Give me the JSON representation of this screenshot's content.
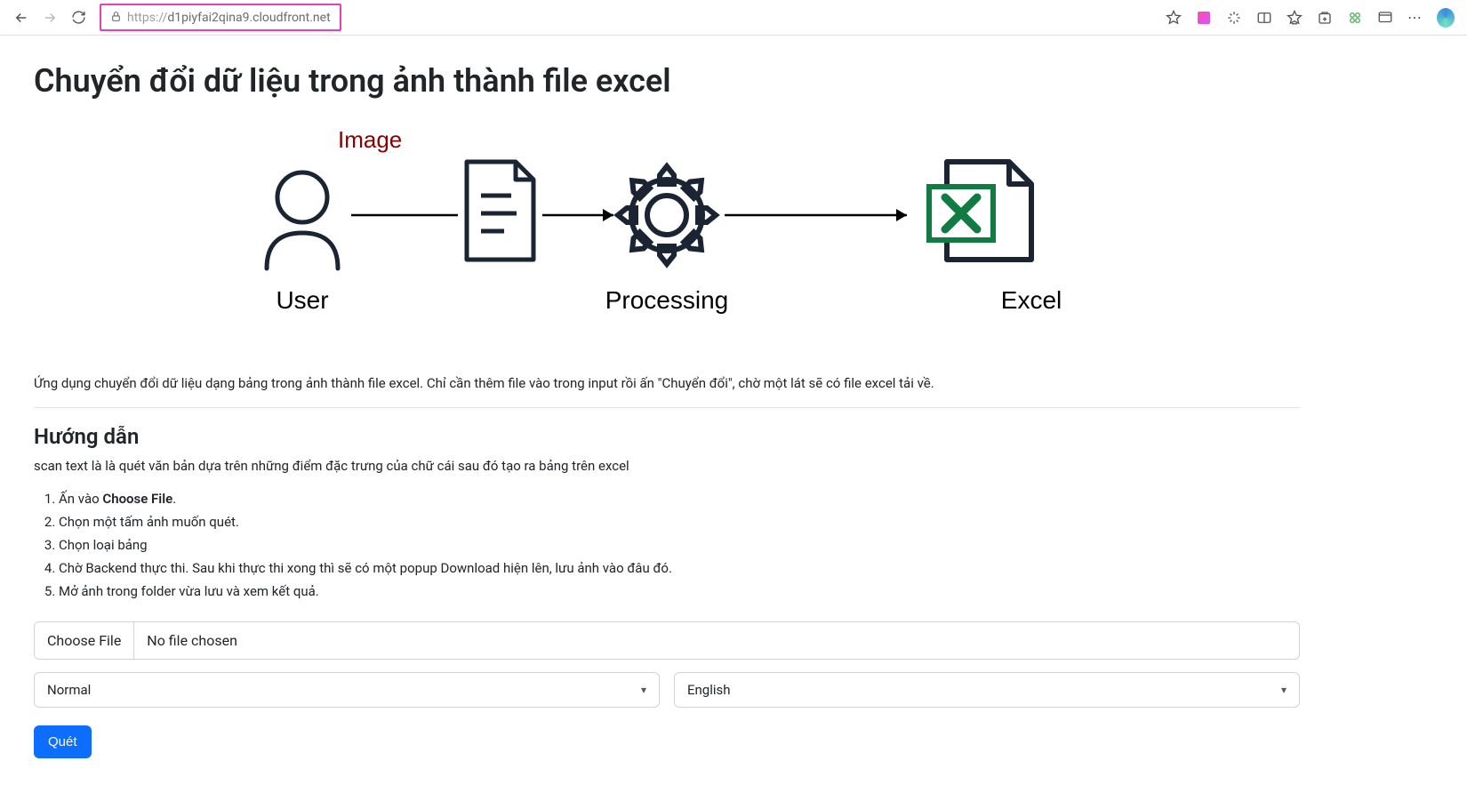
{
  "browser": {
    "url_protocol": "https://",
    "url_host": "d1piyfai2qina9.cloudfront.net"
  },
  "page": {
    "title": "Chuyển đổi dữ liệu trong ảnh thành file excel",
    "diagram": {
      "image_label": "Image",
      "user_label": "User",
      "processing_label": "Processing",
      "excel_label": "Excel"
    },
    "description": "Ứng dụng chuyển đổi dữ liệu dạng bảng trong ảnh thành file excel. Chỉ cần thêm file vào trong input rồi ấn \"Chuyển đổi\", chờ một lát sẽ có file excel tải về.",
    "guide_title": "Hướng dẫn",
    "guide_subdesc": "scan text là là quét văn bản dựa trên những điểm đặc trưng của chữ cái sau đó tạo ra bảng trên excel",
    "steps": {
      "s1_pre": "Ấn vào ",
      "s1_bold": "Choose File",
      "s1_post": ".",
      "s2": "Chọn một tấm ảnh muốn quét.",
      "s3": "Chọn loại bảng",
      "s4": "Chờ Backend thực thi. Sau khi thực thi xong thì sẽ có một popup Download hiện lên, lưu ảnh vào đâu đó.",
      "s5": "Mở ảnh trong folder vừa lưu và xem kết quả."
    },
    "file_input": {
      "choose_label": "Choose File",
      "status": "No file chosen"
    },
    "selects": {
      "mode_value": "Normal",
      "lang_value": "English"
    },
    "scan_button": "Quét"
  }
}
